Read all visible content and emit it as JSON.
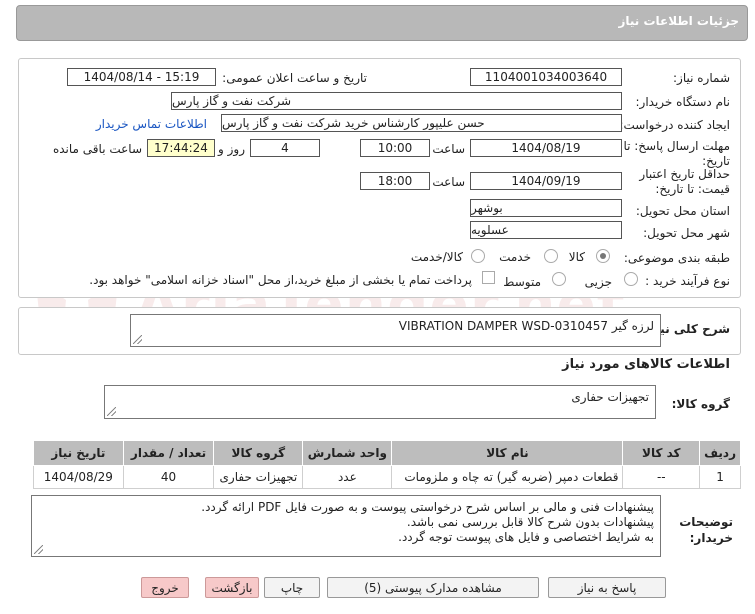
{
  "header": {
    "title": "جزئیات اطلاعات نیاز"
  },
  "form": {
    "need_number_label": "شماره نیاز:",
    "need_number_value": "1104001034003640",
    "announce_label": "تاریخ و ساعت اعلان عمومی:",
    "announce_value": "1404/08/14 - 15:19",
    "buyer_org_label": "نام دستگاه خریدار:",
    "buyer_org_value": "شرکت نفت و گاز پارس",
    "requester_label": "ایجاد کننده درخواست:",
    "requester_value": "حسن علیپور کارشناس خرید شرکت نفت و گاز پارس",
    "buyer_contact_link": "اطلاعات تماس خریدار",
    "reply_deadline_label_1": "مهلت ارسال پاسخ: تا",
    "reply_deadline_label_2": "تاریخ:",
    "reply_date": "1404/08/19",
    "time_label": "ساعت",
    "reply_time": "10:00",
    "days_value": "4",
    "days_label": "روز و",
    "remaining_time": "17:44:24",
    "remaining_label": "ساعت باقی مانده",
    "validity_label_1": "حداقل تاریخ اعتبار",
    "validity_label_2": "قیمت: تا تاریخ:",
    "validity_date": "1404/09/19",
    "validity_time": "18:00",
    "province_label": "استان محل تحویل:",
    "province_value": "بوشهر",
    "city_label": "شهر محل تحویل:",
    "city_value": "عسلویه",
    "category_label": "طبقه بندی موضوعی:",
    "category_options": [
      "کالا",
      "خدمت",
      "کالا/خدمت"
    ],
    "category_selected": "کالا",
    "purchase_type_label": "نوع فرآیند خرید :",
    "purchase_type_options": [
      "جزیی",
      "متوسط"
    ],
    "payment_note": "پرداخت تمام یا بخشی از مبلغ خرید،از محل \"اسناد خزانه اسلامی\" خواهد بود."
  },
  "summary": {
    "label": "شرح کلی نیاز:",
    "value": "لرزه گیر VIBRATION DAMPER WSD-0310457"
  },
  "goods_info": {
    "heading": "اطلاعات کالاهای مورد نیاز",
    "group_label": "گروه کالا:",
    "group_value": "تجهیزات حفاری"
  },
  "table": {
    "headers": [
      "ردیف",
      "کد کالا",
      "نام کالا",
      "واحد شمارش",
      "گروه کالا",
      "تعداد / مقدار",
      "تاریخ نیاز"
    ],
    "rows": [
      [
        "1",
        "--",
        "قطعات دمپر (ضربه گیر) ته چاه و ملزومات",
        "عدد",
        "تجهیزات حفاری",
        "40",
        "1404/08/29"
      ]
    ]
  },
  "buyer_notes": {
    "label_1": "توضیحات",
    "label_2": "خریدار:",
    "lines": [
      "پیشنهادات فنی و مالی بر اساس شرح درخواستی پیوست و به صورت فایل PDF ارائه گردد.",
      "پیشنهادات بدون شرح کالا قابل بررسی نمی باشد.",
      "به شرایط اختصاصی و فایل های پیوست توجه گردد."
    ]
  },
  "buttons": {
    "reply": "پاسخ به نیاز",
    "attachments": "مشاهده مدارک پیوستی (5)",
    "print": "چاپ",
    "back": "بازگشت",
    "exit": "خروج"
  },
  "watermark": {
    "text": "AriaTender.net"
  },
  "colors": {
    "header": "#b8b8b8",
    "link": "#1a56c2",
    "pink_button": "#f7c9c9",
    "highlight": "#ffffcc"
  }
}
